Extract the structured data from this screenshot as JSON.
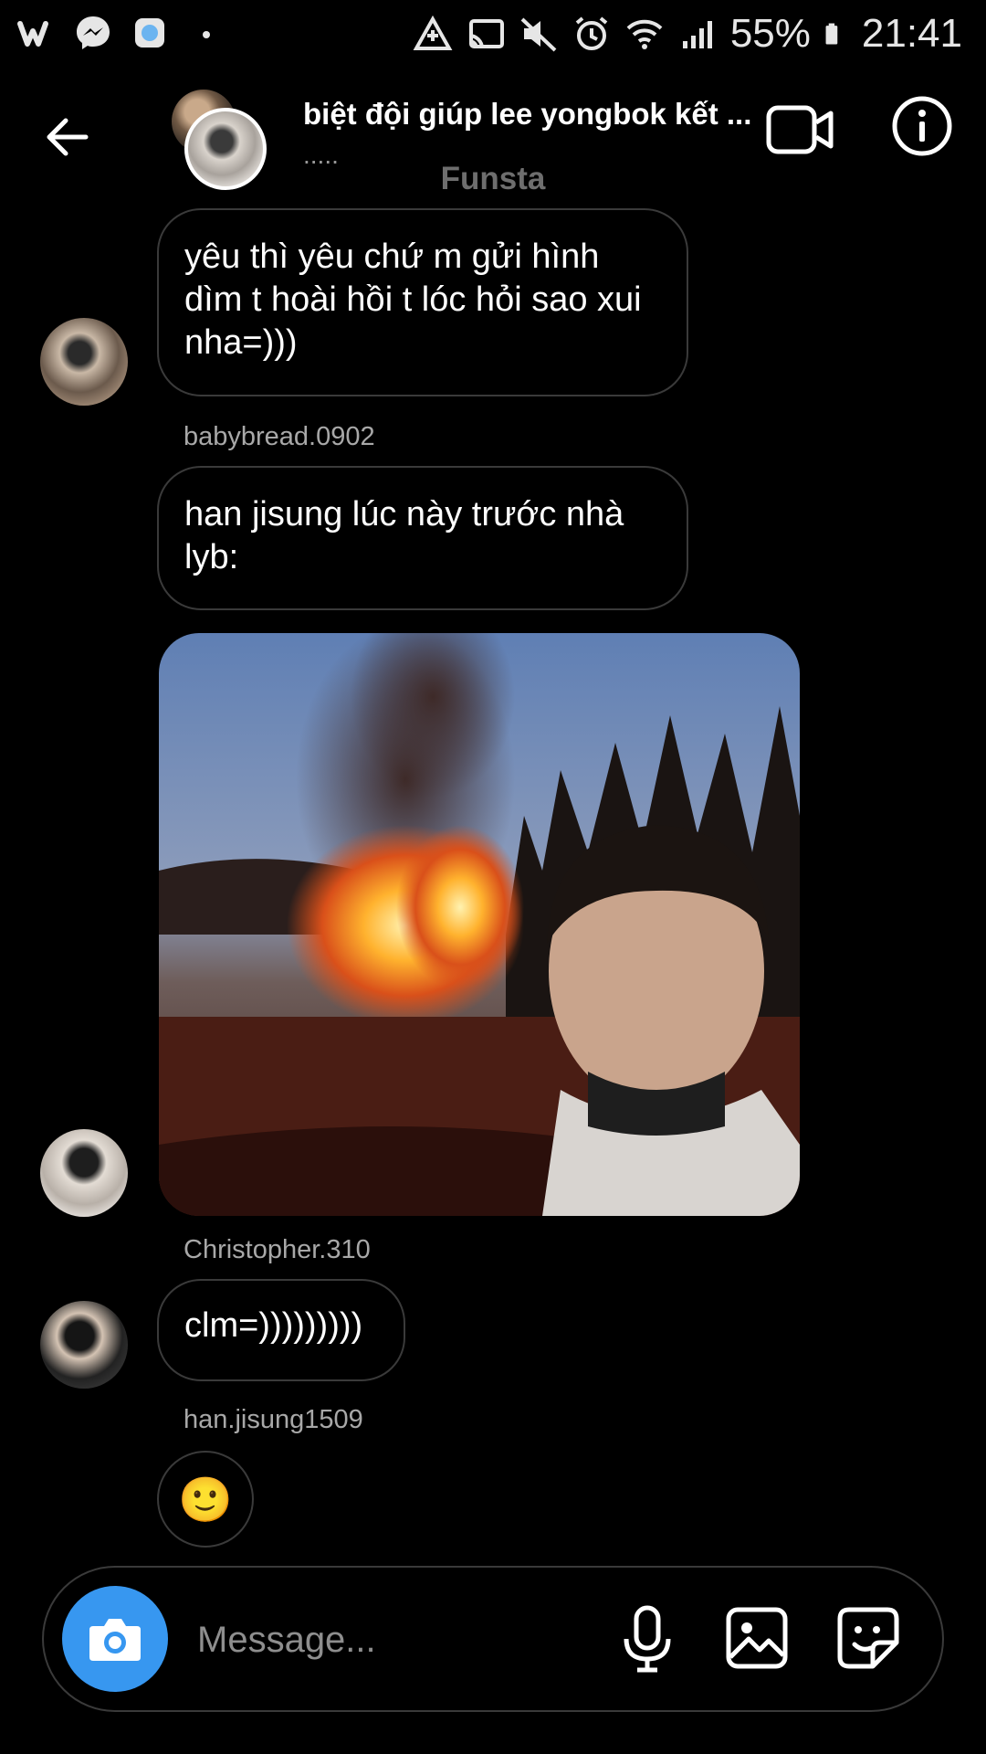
{
  "status_bar": {
    "battery": "55%",
    "time": "21:41",
    "left_icons": [
      "wattpad-icon",
      "messenger-icon",
      "app-icon",
      "dot-icon"
    ],
    "right_icons": [
      "data-saver-icon",
      "cast-icon",
      "mute-icon",
      "alarm-icon",
      "wifi-icon",
      "signal-icon",
      "battery-icon"
    ]
  },
  "header": {
    "title": "biệt đội giúp lee yongbok kết ...",
    "subtitle": ".....",
    "account_label": "Funsta"
  },
  "messages": [
    {
      "text": "yêu thì yêu chứ m gửi hình dìm t hoài hồi t lóc hỏi sao xui nha=)))"
    },
    {
      "sender": "babybread.0902",
      "text": "han jisung lúc này trước nhà lyb:"
    },
    {
      "sender": "Christopher.310",
      "text": "clm=)))))))))"
    },
    {
      "sender": "han.jisung1509",
      "text": "🙂"
    }
  ],
  "composer": {
    "placeholder": "Message..."
  },
  "colors": {
    "background": "#000000",
    "bubble_border": "#3a3a3a",
    "camera_button": "#3797f0",
    "secondary_text": "#a8a8a8"
  }
}
